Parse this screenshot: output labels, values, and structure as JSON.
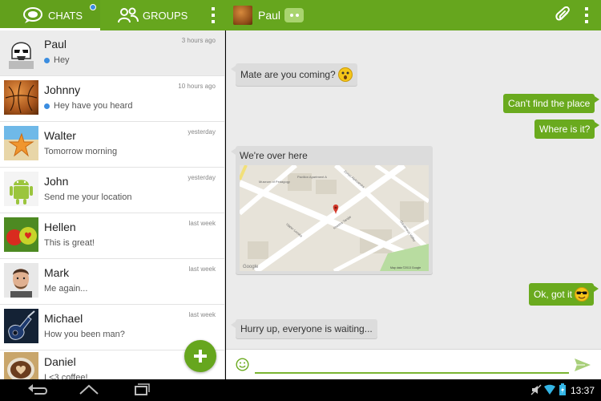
{
  "tabs": {
    "chats_label": "CHATS",
    "groups_label": "GROUPS"
  },
  "header": {
    "contact_name": "Paul"
  },
  "chats": [
    {
      "name": "Paul",
      "message": "Hey",
      "time": "3 hours ago",
      "unread": true,
      "selected": true,
      "avatar": "stormtrooper"
    },
    {
      "name": "Johnny",
      "message": "Hey have you heard",
      "time": "10 hours ago",
      "unread": true,
      "selected": false,
      "avatar": "basketball"
    },
    {
      "name": "Walter",
      "message": "Tomorrow morning",
      "time": "yesterday",
      "unread": false,
      "selected": false,
      "avatar": "starfish"
    },
    {
      "name": "John",
      "message": "Send me your location",
      "time": "yesterday",
      "unread": false,
      "selected": false,
      "avatar": "android"
    },
    {
      "name": "Hellen",
      "message": "This is great!",
      "time": "last week",
      "unread": false,
      "selected": false,
      "avatar": "apples"
    },
    {
      "name": "Mark",
      "message": "Me again...",
      "time": "last week",
      "unread": false,
      "selected": false,
      "avatar": "man-face"
    },
    {
      "name": "Michael",
      "message": "How you been man?",
      "time": "last week",
      "unread": false,
      "selected": false,
      "avatar": "guitar"
    },
    {
      "name": "Daniel",
      "message": "I <3 coffee!",
      "time": "",
      "unread": false,
      "selected": false,
      "avatar": "coffee"
    }
  ],
  "messages": [
    {
      "direction": "in",
      "text": "Mate are you coming?",
      "emoji": "confused-emoji"
    },
    {
      "direction": "out",
      "text": "Can't find the place",
      "emoji": ""
    },
    {
      "direction": "out",
      "text": "Where is it?",
      "emoji": ""
    },
    {
      "direction": "in",
      "text": "We're over here",
      "attachment": "map"
    },
    {
      "direction": "out",
      "text": "Ok, got it",
      "emoji": "sunglasses-emoji"
    },
    {
      "direction": "in",
      "text": "Hurry up, everyone is waiting...",
      "emoji": ""
    }
  ],
  "map": {
    "labels": [
      "Pavillon Apartment A",
      "Museum of Pedagogy",
      "Upper Lovska",
      "Kneeza Tarsjie",
      "Zenyo Aleksandra",
      "Gorokhovo Valley"
    ],
    "brand": "Google",
    "copyright": "Map data ©2013 Google"
  },
  "composer": {
    "placeholder": ""
  },
  "status_bar": {
    "time": "13:37"
  },
  "colors": {
    "accent": "#66a61e",
    "unread_dot": "#3b8de0",
    "incoming_bubble": "#dcdcdc",
    "outgoing_bubble": "#6aaa1e"
  }
}
